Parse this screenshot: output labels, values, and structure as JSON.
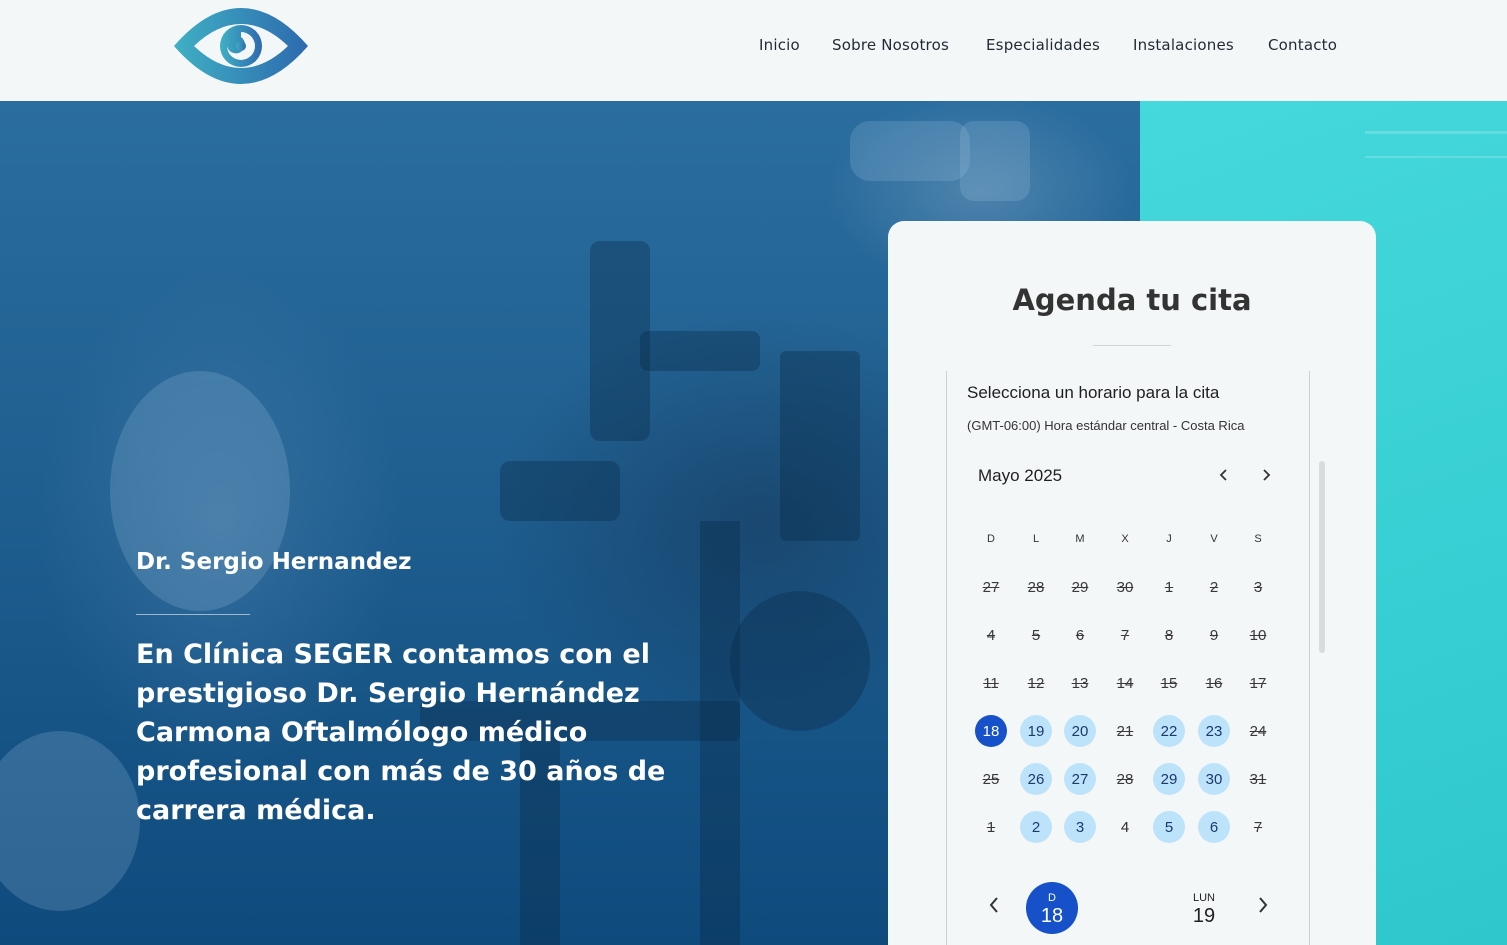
{
  "nav": {
    "items": [
      "Inicio",
      "Sobre Nosotros",
      "Especialidades",
      "Instalaciones",
      "Contacto"
    ]
  },
  "colors": {
    "brand_teal": "#3fb7c6",
    "brand_blue": "#2f6db1",
    "accent_cyan": "#3fd4d8",
    "selected_blue": "#1751c9",
    "available_bg": "#bde3fb"
  },
  "hero": {
    "doctor_name": "Dr. Sergio Hernandez",
    "description": "En Clínica SEGER contamos con el prestigioso Dr. Sergio Hernández Carmona Oftalmólogo médico profesional con más de 30 años de carrera médica."
  },
  "booking": {
    "title": "Agenda tu cita",
    "widget": {
      "heading": "Selecciona un horario para la cita",
      "timezone": "(GMT-06:00) Hora estándar central - Costa Rica",
      "month": "Mayo 2025",
      "weekdays": [
        "D",
        "L",
        "M",
        "X",
        "J",
        "V",
        "S"
      ],
      "weeks": [
        [
          {
            "d": "27",
            "s": "off"
          },
          {
            "d": "28",
            "s": "off"
          },
          {
            "d": "29",
            "s": "off"
          },
          {
            "d": "30",
            "s": "off"
          },
          {
            "d": "1",
            "s": "off"
          },
          {
            "d": "2",
            "s": "off"
          },
          {
            "d": "3",
            "s": "off"
          }
        ],
        [
          {
            "d": "4",
            "s": "off"
          },
          {
            "d": "5",
            "s": "off"
          },
          {
            "d": "6",
            "s": "off"
          },
          {
            "d": "7",
            "s": "off"
          },
          {
            "d": "8",
            "s": "off"
          },
          {
            "d": "9",
            "s": "off"
          },
          {
            "d": "10",
            "s": "off"
          }
        ],
        [
          {
            "d": "11",
            "s": "off"
          },
          {
            "d": "12",
            "s": "off"
          },
          {
            "d": "13",
            "s": "off"
          },
          {
            "d": "14",
            "s": "off"
          },
          {
            "d": "15",
            "s": "off"
          },
          {
            "d": "16",
            "s": "off"
          },
          {
            "d": "17",
            "s": "off"
          }
        ],
        [
          {
            "d": "18",
            "s": "sel"
          },
          {
            "d": "19",
            "s": "avail"
          },
          {
            "d": "20",
            "s": "avail"
          },
          {
            "d": "21",
            "s": "off"
          },
          {
            "d": "22",
            "s": "avail"
          },
          {
            "d": "23",
            "s": "avail"
          },
          {
            "d": "24",
            "s": "off"
          }
        ],
        [
          {
            "d": "25",
            "s": "off"
          },
          {
            "d": "26",
            "s": "avail"
          },
          {
            "d": "27",
            "s": "avail"
          },
          {
            "d": "28",
            "s": "off"
          },
          {
            "d": "29",
            "s": "avail"
          },
          {
            "d": "30",
            "s": "avail"
          },
          {
            "d": "31",
            "s": "off"
          }
        ],
        [
          {
            "d": "1",
            "s": "off"
          },
          {
            "d": "2",
            "s": "avail"
          },
          {
            "d": "3",
            "s": "avail"
          },
          {
            "d": "4",
            "s": "plain"
          },
          {
            "d": "5",
            "s": "avail"
          },
          {
            "d": "6",
            "s": "avail"
          },
          {
            "d": "7",
            "s": "off"
          }
        ]
      ],
      "day_strip": [
        {
          "dow": "D",
          "num": "18",
          "selected": true
        },
        {
          "dow": "LUN",
          "num": "19",
          "selected": false
        }
      ],
      "icons": {
        "prev": "chevron-left-icon",
        "next": "chevron-right-icon"
      }
    }
  }
}
